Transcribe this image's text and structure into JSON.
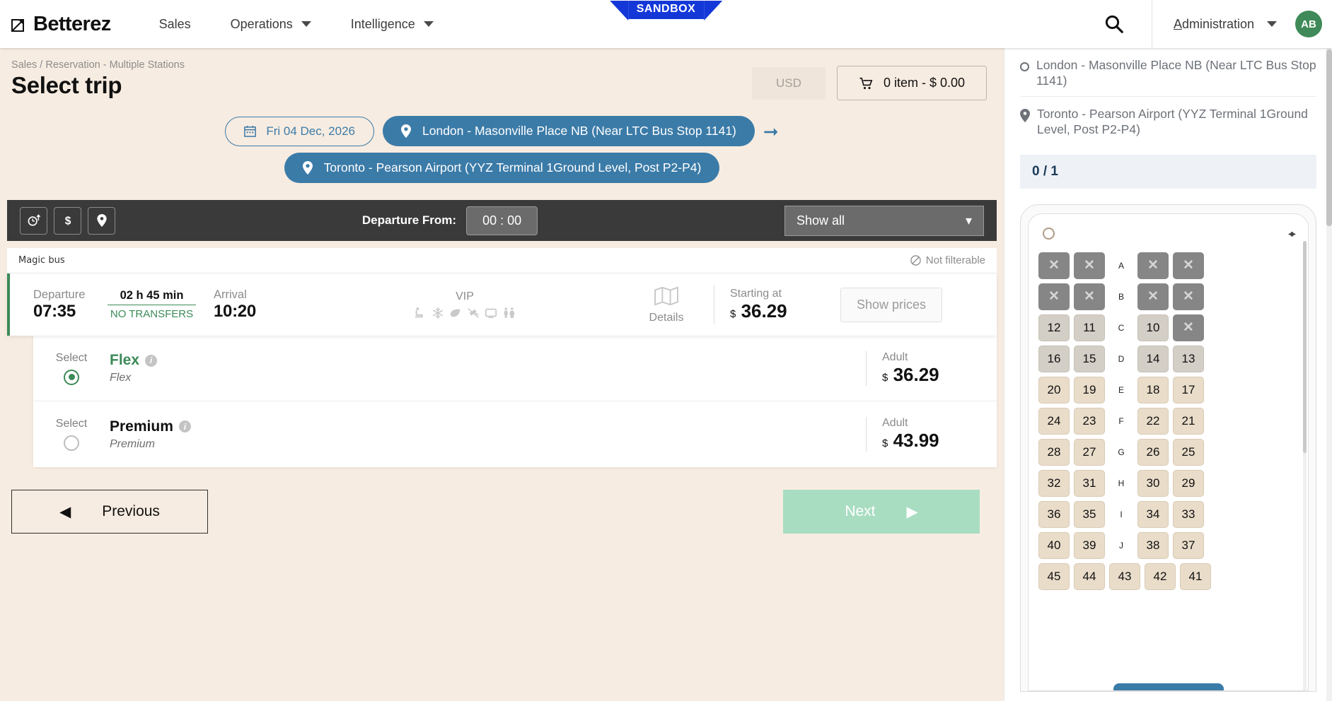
{
  "topnav": {
    "brand": "Betterez",
    "items": [
      {
        "label": "Sales",
        "has_caret": false
      },
      {
        "label": "Operations",
        "has_caret": true
      },
      {
        "label": "Intelligence",
        "has_caret": true
      }
    ],
    "search_icon": "search-icon",
    "admin_label": "Administration",
    "avatar_initials": "AB",
    "sandbox_badge": "SANDBOX"
  },
  "page": {
    "breadcrumb": "Sales / Reservation - Multiple Stations",
    "title": "Select trip",
    "currency": "USD",
    "cart_label": "0 item - $ 0.00",
    "cart_icon": "cart-icon"
  },
  "search": {
    "date": "Fri 04 Dec, 2026",
    "calendar_icon": "calendar-icon",
    "origin": "London - Masonville Place NB (Near LTC Bus Stop 1141)",
    "destination": "Toronto - Pearson Airport (YYZ Terminal 1Ground Level, Post P2-P4)",
    "pin_icon": "map-pin-icon",
    "arrow_icon": "arrow-right-icon"
  },
  "filterbar": {
    "sort_icons": [
      "clock-sort-icon",
      "dollar-sort-icon",
      "pin-sort-icon"
    ],
    "departure_label": "Departure From:",
    "departure_time": "00 : 00",
    "show_select": "Show all",
    "chevron_icon": "chevron-down-icon"
  },
  "trip": {
    "carrier": "Magic bus",
    "not_filterable": "Not filterable",
    "not_filterable_icon": "blocked-icon",
    "departure_label": "Departure",
    "departure_time": "07:35",
    "duration": "02 h 45 min",
    "transfers": "NO TRANSFERS",
    "arrival_label": "Arrival",
    "arrival_time": "10:20",
    "vip_label": "VIP",
    "amenities": [
      "seat-icon",
      "snowflake-icon",
      "leaf-icon",
      "power-plug-icon",
      "tv-screen-icon",
      "restroom-icon"
    ],
    "details_label": "Details",
    "details_icon": "map-fold-icon",
    "starting_at_label": "Starting at",
    "starting_at_currency": "$",
    "starting_at_price": "36.29",
    "show_prices_label": "Show prices"
  },
  "fares": [
    {
      "select_label": "Select",
      "name": "Flex",
      "subtitle": "Flex",
      "selected": true,
      "passenger_type": "Adult",
      "currency": "$",
      "price": "36.29",
      "info_icon": "info-icon"
    },
    {
      "select_label": "Select",
      "name": "Premium",
      "subtitle": "Premium",
      "selected": false,
      "passenger_type": "Adult",
      "currency": "$",
      "price": "43.99",
      "info_icon": "info-icon"
    }
  ],
  "footer": {
    "previous_label": "Previous",
    "previous_icon": "triangle-left-icon",
    "next_label": "Next",
    "next_icon": "triangle-right-icon"
  },
  "rightpanel": {
    "origin": "London - Masonville Place NB (Near LTC Bus Stop 1141)",
    "destination": "Toronto - Pearson Airport (YYZ Terminal 1Ground Level, Post P2-P4)",
    "origin_icon": "circle-outline-icon",
    "destination_icon": "map-pin-icon",
    "counter": "0 / 1",
    "wheel_icon": "steering-wheel-icon",
    "door_icon": "door-icon",
    "seatmap": {
      "rows": [
        {
          "label": "A",
          "left": [
            {
              "v": "x",
              "s": "blocked"
            },
            {
              "v": "x",
              "s": "blocked"
            }
          ],
          "right": [
            {
              "v": "x",
              "s": "blocked"
            },
            {
              "v": "x",
              "s": "blocked"
            }
          ]
        },
        {
          "label": "B",
          "left": [
            {
              "v": "x",
              "s": "blocked"
            },
            {
              "v": "x",
              "s": "blocked"
            }
          ],
          "right": [
            {
              "v": "x",
              "s": "blocked"
            },
            {
              "v": "x",
              "s": "blocked"
            }
          ]
        },
        {
          "label": "C",
          "left": [
            {
              "v": "12",
              "s": "grey"
            },
            {
              "v": "11",
              "s": "grey"
            }
          ],
          "right": [
            {
              "v": "10",
              "s": "grey"
            },
            {
              "v": "x",
              "s": "blocked"
            }
          ]
        },
        {
          "label": "D",
          "left": [
            {
              "v": "16",
              "s": "grey"
            },
            {
              "v": "15",
              "s": "grey"
            }
          ],
          "right": [
            {
              "v": "14",
              "s": "grey"
            },
            {
              "v": "13",
              "s": "grey"
            }
          ]
        },
        {
          "label": "E",
          "left": [
            {
              "v": "20",
              "s": "beige"
            },
            {
              "v": "19",
              "s": "beige"
            }
          ],
          "right": [
            {
              "v": "18",
              "s": "beige"
            },
            {
              "v": "17",
              "s": "beige"
            }
          ]
        },
        {
          "label": "F",
          "left": [
            {
              "v": "24",
              "s": "beige"
            },
            {
              "v": "23",
              "s": "beige"
            }
          ],
          "right": [
            {
              "v": "22",
              "s": "beige"
            },
            {
              "v": "21",
              "s": "beige"
            }
          ]
        },
        {
          "label": "G",
          "left": [
            {
              "v": "28",
              "s": "beige"
            },
            {
              "v": "27",
              "s": "beige"
            }
          ],
          "right": [
            {
              "v": "26",
              "s": "beige"
            },
            {
              "v": "25",
              "s": "beige"
            }
          ]
        },
        {
          "label": "H",
          "left": [
            {
              "v": "32",
              "s": "beige"
            },
            {
              "v": "31",
              "s": "beige"
            }
          ],
          "right": [
            {
              "v": "30",
              "s": "beige"
            },
            {
              "v": "29",
              "s": "beige"
            }
          ]
        },
        {
          "label": "I",
          "left": [
            {
              "v": "36",
              "s": "beige"
            },
            {
              "v": "35",
              "s": "beige"
            }
          ],
          "right": [
            {
              "v": "34",
              "s": "beige"
            },
            {
              "v": "33",
              "s": "beige"
            }
          ]
        },
        {
          "label": "J",
          "left": [
            {
              "v": "40",
              "s": "beige"
            },
            {
              "v": "39",
              "s": "beige"
            }
          ],
          "right": [
            {
              "v": "38",
              "s": "beige"
            },
            {
              "v": "37",
              "s": "beige"
            }
          ]
        },
        {
          "label": "",
          "left": [
            {
              "v": "45",
              "s": "beige"
            },
            {
              "v": "44",
              "s": "beige"
            }
          ],
          "middle": [
            {
              "v": "43",
              "s": "beige"
            }
          ],
          "right": [
            {
              "v": "42",
              "s": "beige"
            },
            {
              "v": "41",
              "s": "beige"
            }
          ]
        }
      ]
    }
  },
  "colors": {
    "accent_blue": "#3b7ba8",
    "accent_green": "#3c8a58",
    "page_bg": "#f7ece1",
    "dark_bar": "#3a3a3a",
    "sandbox_blue": "#1438d8"
  }
}
